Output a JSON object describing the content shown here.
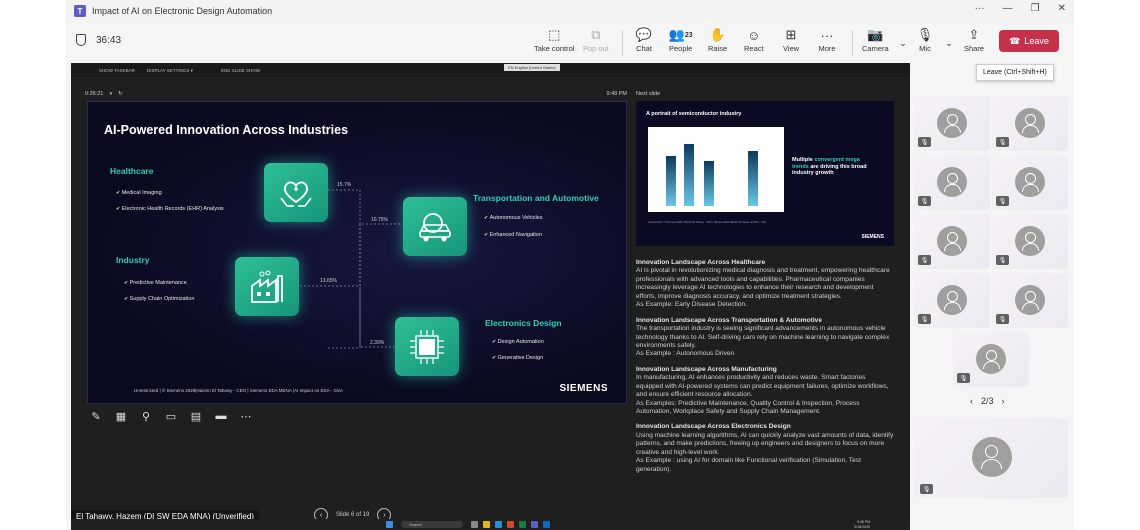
{
  "window": {
    "title": "Impact of AI on Electronic Design Automation",
    "min": "—",
    "restore": "❐",
    "close": "✕",
    "more": "···"
  },
  "toolbar": {
    "timer": "36:43",
    "take_control": "Take control",
    "pop_out": "Pop out",
    "chat": "Chat",
    "people": "People",
    "people_count": "23",
    "raise": "Raise",
    "react": "React",
    "view": "View",
    "more": "More",
    "camera": "Camera",
    "mic": "Mic",
    "share": "Share",
    "leave": "Leave",
    "leave_tooltip": "Leave (Ctrl+Shift+H)",
    "leave_color": "#c4314b"
  },
  "presenter_bar": {
    "show_taskbar": "SHOW TASKBAR",
    "display_settings": "DISPLAY SETTINGS ▾",
    "end_show": "END SLIDE SHOW",
    "language": "EN English (United States)",
    "elapsed": "0:26:21",
    "clock": "9:48 PM",
    "next_slide": "Next slide"
  },
  "slide": {
    "title": "AI-Powered Innovation Across Industries",
    "healthcare": {
      "title": "Healthcare",
      "bullets": [
        "Medical Imaging",
        "Electronic Health Records (EHR) Analysis"
      ],
      "pct": "15.7%"
    },
    "transport": {
      "title": "Transportation and Automotive",
      "bullets": [
        "Autonomous Vehicles",
        "Enhanced Navigation"
      ],
      "pct": "10.75%"
    },
    "industry": {
      "title": "Industry",
      "bullets": [
        "Predictive Maintenance",
        "Supply Chain Optimization"
      ],
      "pct": "13.65%"
    },
    "electronics": {
      "title": "Electronics Design",
      "bullets": [
        "Design Automation",
        "Generative Design"
      ],
      "pct": "2.39%"
    },
    "footer": "Unrestricted | © Siemens 2025|Hazem El Tahawy - CEO | Siemens EDA MENA |AI Impact on EDA - GSA",
    "brand": "SIEMENS",
    "accent": "#2ecfb7"
  },
  "next_slide": {
    "title": "A portrait of semiconductor industry",
    "text_a": "Multiple ",
    "text_b": "convergent mega trends",
    "text_c": " are driving this broad industry growth",
    "brand": "SIEMENS",
    "foot": "Unrestricted | © Siemens 2025 | Hazem El Tahawy - CEO | Siemens EDA MENA | AI Impact on EDA - GSA"
  },
  "notes": [
    {
      "h": "Innovation Landscape Across Healthcare",
      "body": "AI is pivotal in revolutionizing medical diagnosis and treatment, empowering healthcare professionals with advanced tools and capabilities. Pharmaceutical companies increasingly leverage AI technologies to enhance their research and development efforts, improve diagnosis accuracy, and optimize treatment strategies.",
      "ex": "As Example: Early Disease Detection."
    },
    {
      "h": "Innovation Landscape Across Transportation & Automotive",
      "body": "The transportation industry is seeing significant advancements in autonomous vehicle technology thanks to AI. Self-driving cars rely on machine learning to navigate complex environments safely.",
      "ex": "As Example : Autonomous Driven"
    },
    {
      "h": "Innovation Landscape Across Manufacturing",
      "body": "In manufacturing, AI enhances productivity and reduces waste. Smart factories equipped with AI-powered systems can predict equipment failures, optimize workflows, and ensure efficient resource allocation.",
      "ex": "As Examples: Predictive Maintenance, Quality Control & Inspection, Process Automation, Workplace Safety and Supply Chain Management."
    },
    {
      "h": "Innovation Landscape Across Electronics Design",
      "body": "Using machine learning algorithms, AI can quickly analyze vast amounts of data, identify patterns, and make predictions, freeing up engineers and designers to focus on more creative and high-level work.",
      "ex": "As Example : using AI for domain like Functional verification (Simulation, Test generation)."
    }
  ],
  "slide_nav": {
    "label": "Slide 6 of 19"
  },
  "presenter_name": "El Tahawy, Hazem (DI SW EDA MNA) (Unverified)",
  "taskbar": {
    "search": "Search",
    "time": "9:48 PM",
    "date": "5/18/2025"
  },
  "gallery": {
    "pager": "2/3"
  }
}
